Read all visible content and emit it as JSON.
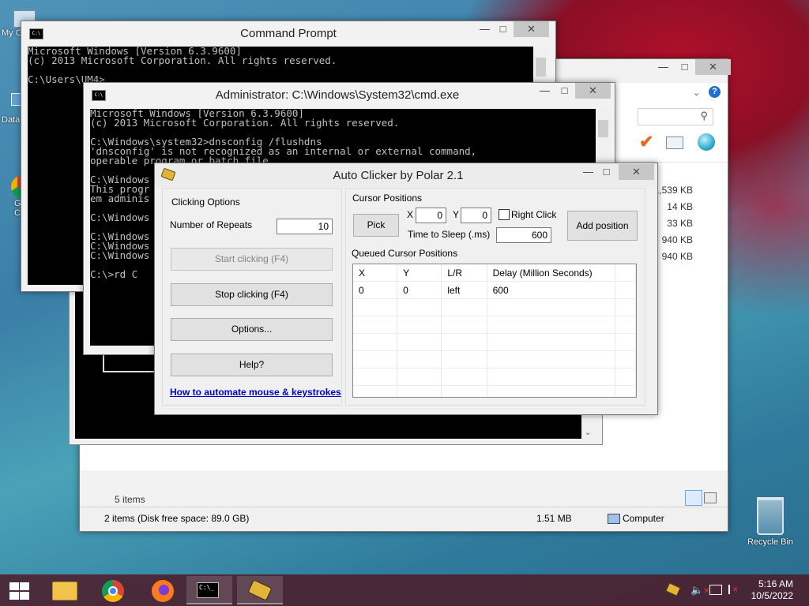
{
  "desktop": {
    "icons": [
      {
        "label": "My C"
      },
      {
        "label": "Data"
      },
      {
        "label": "G"
      },
      {
        "label": "C"
      }
    ],
    "recycle_bin": "Recycle Bin"
  },
  "explorer": {
    "search_icon": "search-icon",
    "help_icon": "?",
    "sizes": [
      "1,539 KB",
      "14 KB",
      "33 KB",
      "940 KB",
      "940 KB"
    ],
    "items_count": "5 items",
    "status_left": "2 items (Disk free space: 89.0 GB)",
    "status_size": "1.51 MB",
    "status_location": "Computer"
  },
  "cmd1": {
    "title": "Command Prompt",
    "lines": "Microsoft Windows [Version 6.3.9600]\n(c) 2013 Microsoft Corporation. All rights reserved.\n\nC:\\Users\\UM4>"
  },
  "cmd2": {
    "title": "Administrator: C:\\Windows\\System32\\cmd.exe",
    "lines": "Microsoft Windows [Version 6.3.9600]\n(c) 2013 Microsoft Corporation. All rights reserved.\n\nC:\\Windows\\system32>dnsconfig /flushdns\n'dnsconfig' is not recognized as an internal or external command,\noperable program or batch file.\n\nC:\\Windows\nThis progr\nem adminis\n\nC:\\Windows\n\nC:\\Windows\nC:\\Windows\nC:\\Windows\n\nC:\\>rd C"
  },
  "autoclicker": {
    "title": "Auto Clicker by Polar 2.1",
    "clicking_options": {
      "label": "Clicking Options",
      "repeats_label": "Number of Repeats",
      "repeats_value": "10",
      "start_button": "Start clicking (F4)",
      "stop_button": "Stop clicking (F4)",
      "options_button": "Options...",
      "help_button": "Help?",
      "automate_link": "How to automate mouse & keystrokes"
    },
    "cursor_positions": {
      "label": "Cursor Positions",
      "pick_button": "Pick",
      "x_label": "X",
      "x_value": "0",
      "y_label": "Y",
      "y_value": "0",
      "right_click_label": "Right Click",
      "right_click_checked": false,
      "sleep_label": "Time to Sleep (.ms)",
      "sleep_value": "600",
      "add_button": "Add position",
      "queued_label": "Queued Cursor Positions",
      "columns": [
        "X",
        "Y",
        "L/R",
        "Delay (Million Seconds)"
      ],
      "rows": [
        [
          "0",
          "0",
          "left",
          "600"
        ]
      ]
    }
  },
  "taskbar": {
    "clock_time": "5:16 AM",
    "clock_date": "10/5/2022"
  }
}
